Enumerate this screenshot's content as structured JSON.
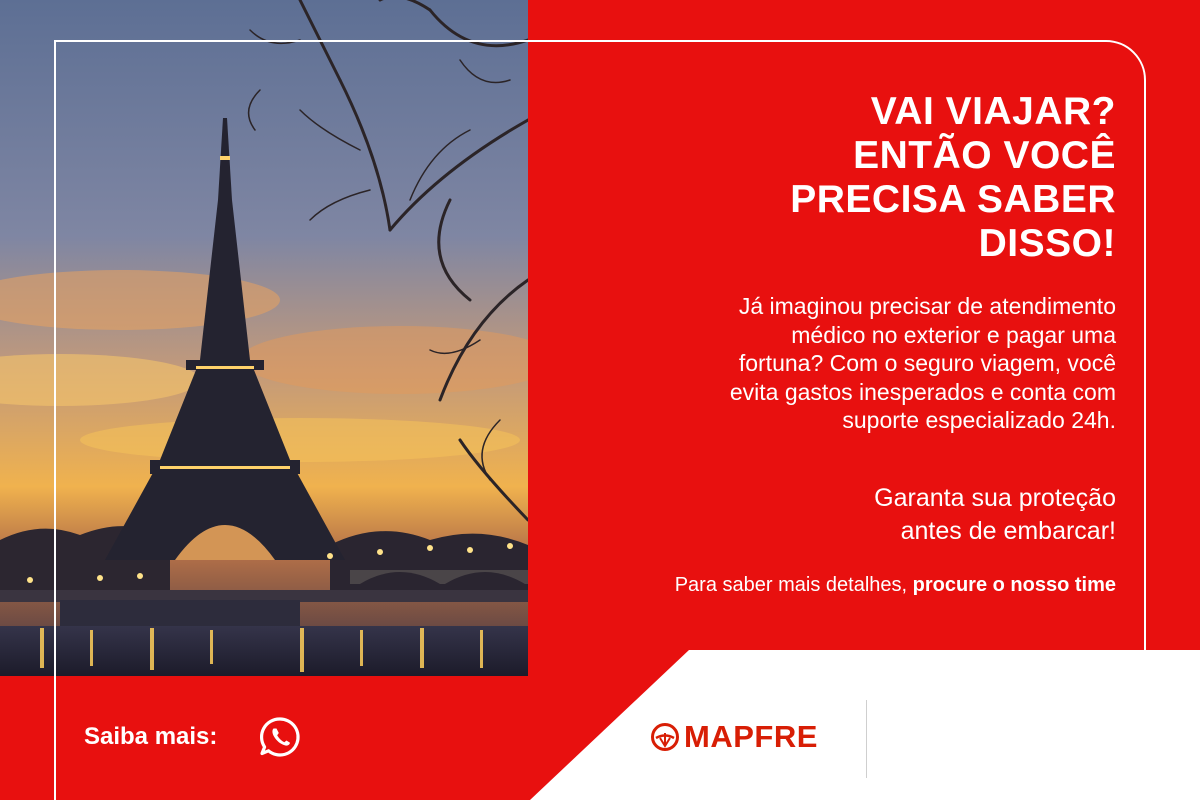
{
  "headline": {
    "line1": "VAI VIAJAR?",
    "line2": "ENTÃO VOCÊ",
    "line3": "PRECISA SABER",
    "line4": "DISSO!"
  },
  "body": {
    "line1": "Já imaginou precisar de atendimento",
    "line2": "médico no exterior e pagar uma",
    "line3": "fortuna? Com o seguro viagem, você",
    "line4": "evita gastos inesperados e conta com",
    "line5": "suporte especializado 24h."
  },
  "cta": {
    "line1": "Garanta sua proteção",
    "line2": "antes de embarcar!"
  },
  "more": {
    "prefix": "Para saber mais detalhes, ",
    "strong": "procure o nosso time"
  },
  "footer": {
    "saiba_label": "Saiba mais:",
    "whatsapp_icon": "whatsapp-icon"
  },
  "brand": {
    "name": "MAPFRE",
    "color": "#d81e05",
    "accent": "#e8100f"
  }
}
